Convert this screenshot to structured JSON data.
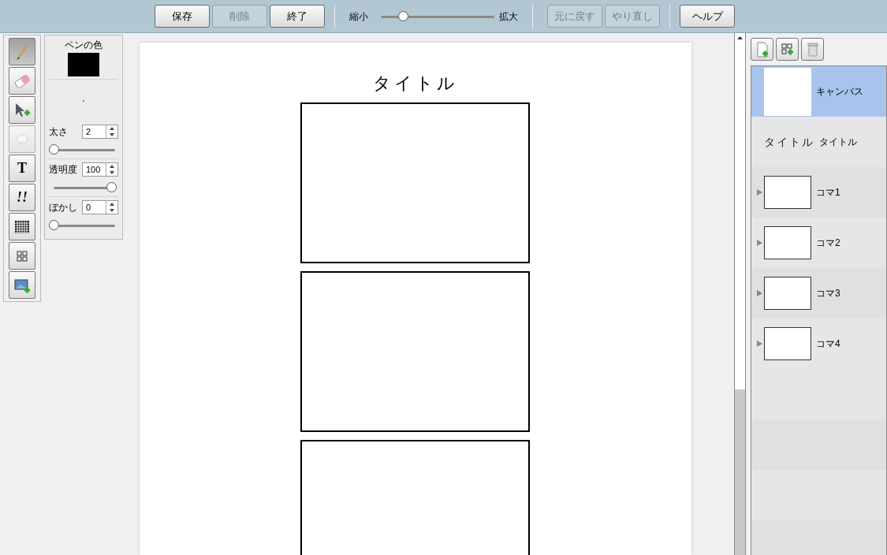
{
  "toolbar": {
    "buttons": [
      {
        "label": "保存",
        "disabled": false
      },
      {
        "label": "削除",
        "disabled": true
      },
      {
        "label": "終了",
        "disabled": false
      }
    ],
    "zoom": {
      "min_label": "縮小",
      "max_label": "拡大",
      "level": 0.2
    },
    "history_buttons": [
      {
        "label": "元に戻す",
        "disabled": true
      },
      {
        "label": "やり直し",
        "disabled": true
      }
    ],
    "help_button": {
      "label": "ヘルプ",
      "disabled": false
    }
  },
  "tools": [
    {
      "kind": "pen",
      "selected": true,
      "disabled": false
    },
    {
      "kind": "eraser",
      "selected": false,
      "disabled": false
    },
    {
      "kind": "select",
      "selected": false,
      "disabled": false
    },
    {
      "kind": "balloon",
      "selected": false,
      "disabled": true
    },
    {
      "kind": "text",
      "label": "T",
      "selected": false,
      "disabled": false
    },
    {
      "kind": "effect",
      "label": "!!",
      "selected": false,
      "disabled": false
    },
    {
      "kind": "tone",
      "selected": false,
      "disabled": false
    },
    {
      "kind": "panels",
      "selected": false,
      "disabled": false
    },
    {
      "kind": "image",
      "selected": false,
      "disabled": false
    }
  ],
  "pen_panel": {
    "color_label": "ペンの色",
    "color": "#000000",
    "preview": ".",
    "settings": [
      {
        "label": "太さ",
        "value": "2",
        "level": 0
      },
      {
        "label": "透明度",
        "value": "100",
        "level": 1
      },
      {
        "label": "ぼかし",
        "value": "0",
        "level": 0
      }
    ]
  },
  "page": {
    "title": "タイトル",
    "panels": [
      {
        "kind": "frame"
      },
      {
        "kind": "frame"
      },
      {
        "kind": "frame"
      }
    ]
  },
  "layers": {
    "actions": [
      {
        "kind": "add-page"
      },
      {
        "kind": "add-panels"
      },
      {
        "kind": "delete"
      }
    ],
    "items": [
      {
        "kind": "canvas",
        "label": "キャンバス",
        "selected": true
      },
      {
        "kind": "text",
        "preview": "タイトル",
        "label": "タイトル",
        "selected": false
      },
      {
        "kind": "panel",
        "label": "コマ1",
        "selected": false
      },
      {
        "kind": "panel",
        "label": "コマ2",
        "selected": false
      },
      {
        "kind": "panel",
        "label": "コマ3",
        "selected": false
      },
      {
        "kind": "panel",
        "label": "コマ4",
        "selected": false
      }
    ]
  }
}
